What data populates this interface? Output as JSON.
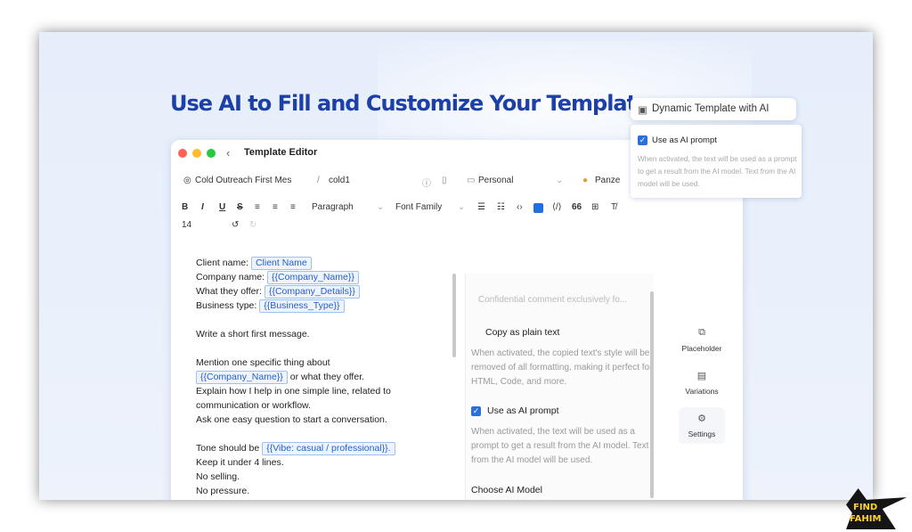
{
  "headline": "Use AI to Fill and Customize Your Templates",
  "window": {
    "title": "Template Editor",
    "back_glyph": "‹",
    "meta": {
      "template_name": "Cold Outreach First Mes",
      "slug": "cold1",
      "category": "Personal",
      "author": "Panze"
    },
    "toolbar": {
      "bold": "B",
      "italic": "I",
      "underline": "U",
      "strike": "S",
      "paragraph": "Paragraph",
      "font_family": "Font Family",
      "quote_count": "66",
      "font_size": "14"
    }
  },
  "editor": {
    "lines": [
      {
        "text": "Client name:",
        "ph": "Client Name"
      },
      {
        "text": "Company name:",
        "ph": "{{Company_Name}}"
      },
      {
        "text": "What they offer:",
        "ph": "{{Company_Details}}"
      },
      {
        "text": "Business type:",
        "ph": "{{Business_Type}}"
      }
    ],
    "instruction_1": "Write a short first message.",
    "instruction_2": "Mention one specific thing about",
    "instruction_2_ph": "{{Company_Name}}",
    "instruction_2_tail": "or what they offer.",
    "instruction_3": "Explain how I help in one simple line, related to",
    "instruction_4": "communication or workflow.",
    "instruction_5": "Ask one easy question to start a conversation.",
    "tone_label": "Tone should be",
    "tone_ph": "{{Vibe: casual / professional}}.",
    "rule_1": "Keep it under 4 lines.",
    "rule_2": "No selling.",
    "rule_3": "No pressure."
  },
  "settings_panel": {
    "comment_placeholder": "Confidential comment exclusively fo...",
    "copy_plain_label": "Copy as plain text",
    "copy_plain_desc": "When activated, the copied text's style will be removed of all formatting, making it perfect for HTML, Code, and more.",
    "ai_prompt_label": "Use as AI prompt",
    "ai_prompt_desc": "When activated, the text will be used as a prompt to get a result from the AI model. Text from the AI model will be used.",
    "choose_model_label": "Choose AI Model"
  },
  "side_nav": {
    "placeholder": "Placeholder",
    "variations": "Variations",
    "settings": "Settings"
  },
  "callout": {
    "title": "Dynamic Template with AI",
    "checkbox_label": "Use as AI prompt",
    "description": "When activated, the text will be used as a prompt to get a result from the AI model. Text from the AI model will be used."
  },
  "watermark": {
    "line1": "FIND",
    "line2": "FAHIM"
  },
  "colors": {
    "headline": "#1d3fa8",
    "accent": "#2b6fdb",
    "placeholder_border": "#9ec2ef"
  }
}
